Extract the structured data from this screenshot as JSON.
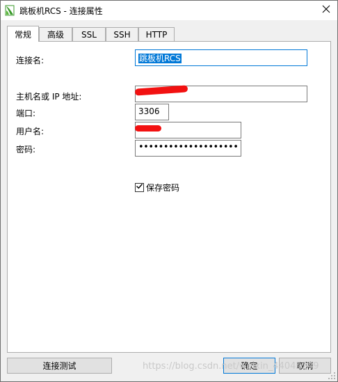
{
  "window": {
    "title": "跳板机RCS - 连接属性"
  },
  "tabs": [
    "常规",
    "高级",
    "SSL",
    "SSH",
    "HTTP"
  ],
  "active_tab": "常规",
  "form": {
    "connection_name_label": "连接名:",
    "connection_name_value": "跳板机RCS",
    "host_label": "主机名或 IP 地址:",
    "port_label": "端口:",
    "port_value": "3306",
    "user_label": "用户名:",
    "password_label": "密码:",
    "password_value": "••••••••••••••••••••",
    "save_password_label": "保存密码",
    "save_password_checked": true
  },
  "buttons": {
    "test_connection": "连接测试",
    "ok": "确定",
    "cancel": "取消"
  },
  "watermark": "https://blog.csdn.net/weixin_44045249",
  "colors": {
    "accent": "#0078d7",
    "redaction": "#f21111",
    "window_bg": "#f0f0f0",
    "app_icon": "#3a9a2a"
  },
  "icons": {
    "app": "navicat-leaf-icon",
    "close": "close-icon",
    "check": "checkmark-icon"
  }
}
